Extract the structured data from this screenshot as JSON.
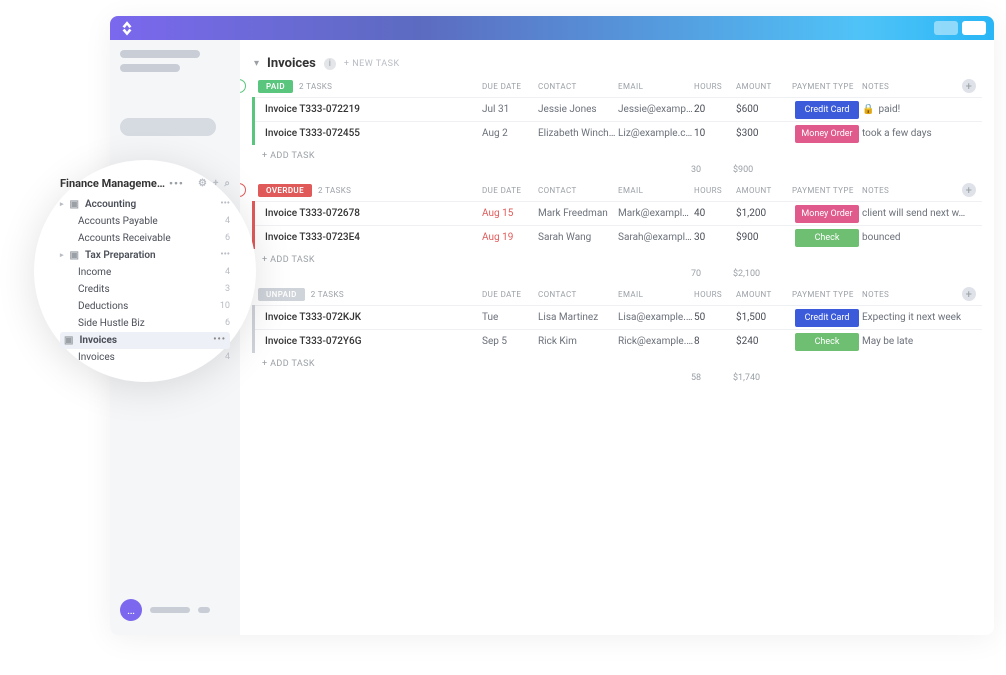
{
  "main": {
    "title": "Invoices",
    "new_task_label": "+ NEW TASK",
    "columns": {
      "due": "DUE DATE",
      "contact": "CONTACT",
      "email": "EMAIL",
      "hours": "HOURS",
      "amount": "AMOUNT",
      "payment": "PAYMENT TYPE",
      "notes": "NOTES"
    },
    "add_task_label": "+ ADD TASK",
    "groups": [
      {
        "status": "PAID",
        "accent": "green",
        "pill_color": "#5ac57d",
        "task_count": "2 TASKS",
        "rows": [
          {
            "name": "Invoice T333-072219",
            "due": "Jul 31",
            "overdue": false,
            "contact": "Jessie Jones",
            "email": "Jessie@example.com",
            "hours": "20",
            "amount": "$600",
            "payment": "credit-card",
            "payment_label": "Credit Card",
            "notes": "paid!",
            "locked": true
          },
          {
            "name": "Invoice T333-072455",
            "due": "Aug 2",
            "overdue": false,
            "contact": "Elizabeth Wincheste",
            "email": "Liz@example.com",
            "hours": "10",
            "amount": "$300",
            "payment": "money-order",
            "payment_label": "Money Order",
            "notes": "took a few days",
            "locked": false
          }
        ],
        "total_hours": "30",
        "total_amount": "$900"
      },
      {
        "status": "OVERDUE",
        "accent": "red",
        "pill_color": "#e05a5a",
        "task_count": "2 TASKS",
        "rows": [
          {
            "name": "Invoice T333-072678",
            "due": "Aug 15",
            "overdue": true,
            "contact": "Mark Freedman",
            "email": "Mark@example.com",
            "hours": "40",
            "amount": "$1,200",
            "payment": "money-order",
            "payment_label": "Money Order",
            "notes": "client will send next w…",
            "locked": false
          },
          {
            "name": "Invoice T333-0723E4",
            "due": "Aug 19",
            "overdue": true,
            "contact": "Sarah Wang",
            "email": "Sarah@example.com",
            "hours": "30",
            "amount": "$900",
            "payment": "check",
            "payment_label": "Check",
            "notes": "bounced",
            "locked": false
          }
        ],
        "total_hours": "70",
        "total_amount": "$2,100"
      },
      {
        "status": "UNPAID",
        "accent": "grey",
        "pill_color": "#cfd3da",
        "task_count": "2 TASKS",
        "rows": [
          {
            "name": "Invoice T333-072KJK",
            "due": "Tue",
            "overdue": false,
            "contact": "Lisa Martinez",
            "email": "Lisa@example.com",
            "hours": "50",
            "amount": "$1,500",
            "payment": "credit-card",
            "payment_label": "Credit Card",
            "notes": "Expecting it next week",
            "locked": false
          },
          {
            "name": "Invoice T333-072Y6G",
            "due": "Sep 5",
            "overdue": false,
            "contact": "Rick Kim",
            "email": "Rick@example.com",
            "hours": "8",
            "amount": "$240",
            "payment": "check",
            "payment_label": "Check",
            "notes": "May be late",
            "locked": false
          }
        ],
        "total_hours": "58",
        "total_amount": "$1,740"
      }
    ]
  },
  "popover": {
    "title": "Finance Manageme…",
    "folders": [
      {
        "name": "Accounting",
        "items": [
          {
            "label": "Accounts Payable",
            "count": "4"
          },
          {
            "label": "Accounts Receivable",
            "count": "6"
          }
        ]
      },
      {
        "name": "Tax Preparation",
        "items": [
          {
            "label": "Income",
            "count": "4"
          },
          {
            "label": "Credits",
            "count": "3"
          },
          {
            "label": "Deductions",
            "count": "10"
          },
          {
            "label": "Side Hustle Biz",
            "count": "6"
          }
        ]
      }
    ],
    "active_folder": "Invoices",
    "active_items": [
      {
        "label": "Invoices",
        "count": "4"
      }
    ]
  }
}
